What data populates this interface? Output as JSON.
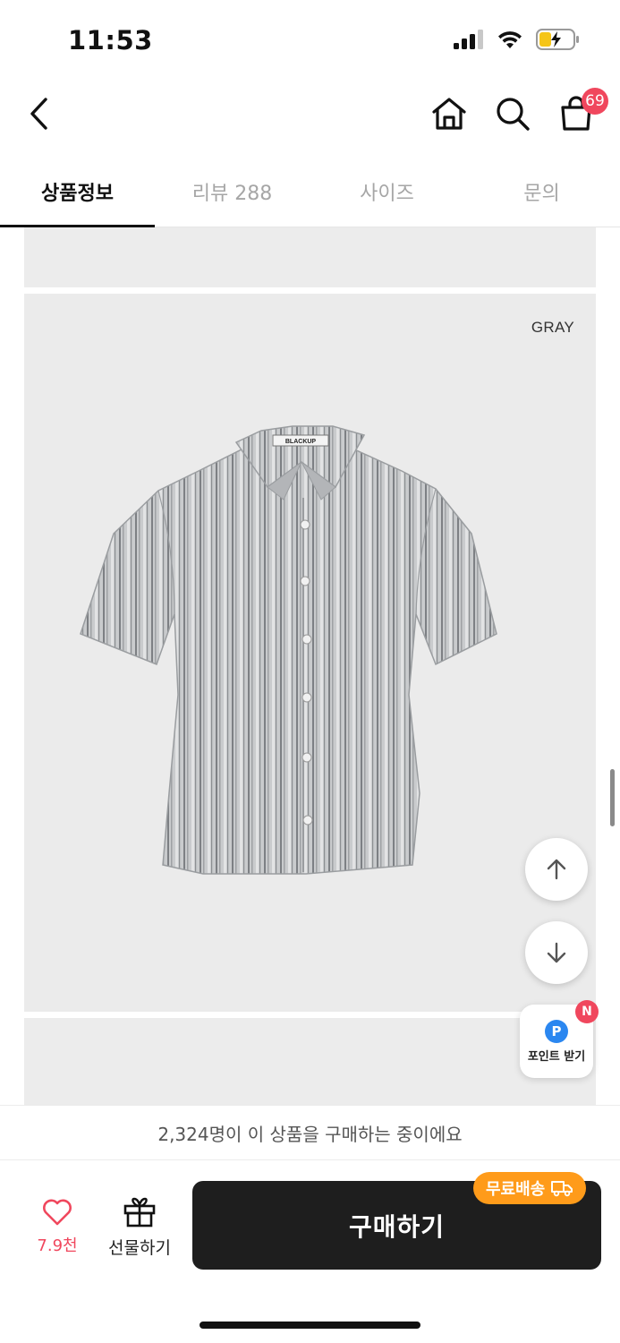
{
  "status_bar": {
    "time": "11:53"
  },
  "header": {
    "cart_count": "69"
  },
  "tabs": [
    {
      "label": "상품정보",
      "active": true
    },
    {
      "label": "리뷰 288",
      "active": false
    },
    {
      "label": "사이즈",
      "active": false
    },
    {
      "label": "문의",
      "active": false
    }
  ],
  "product_image": {
    "color_label": "GRAY",
    "brand_tag": "BLACKUP"
  },
  "floating": {
    "point_label": "포인트 받기",
    "point_icon": "P",
    "new_badge": "N"
  },
  "info_strip": {
    "text": "2,324명이 이 상품을 구매하는 중이에요"
  },
  "bottom_bar": {
    "like_count": "7.9천",
    "gift_label": "선물하기",
    "buy_label": "구매하기",
    "shipping_badge": "무료배송"
  },
  "colors": {
    "accent_red": "#f0475d",
    "shipping_orange": "#ff9b1a",
    "buy_button": "#1e1e1e"
  },
  "icons": [
    "back-arrow-icon",
    "home-icon",
    "search-icon",
    "shopping-bag-icon",
    "arrow-up-icon",
    "arrow-down-icon",
    "heart-icon",
    "gift-icon",
    "truck-icon"
  ]
}
